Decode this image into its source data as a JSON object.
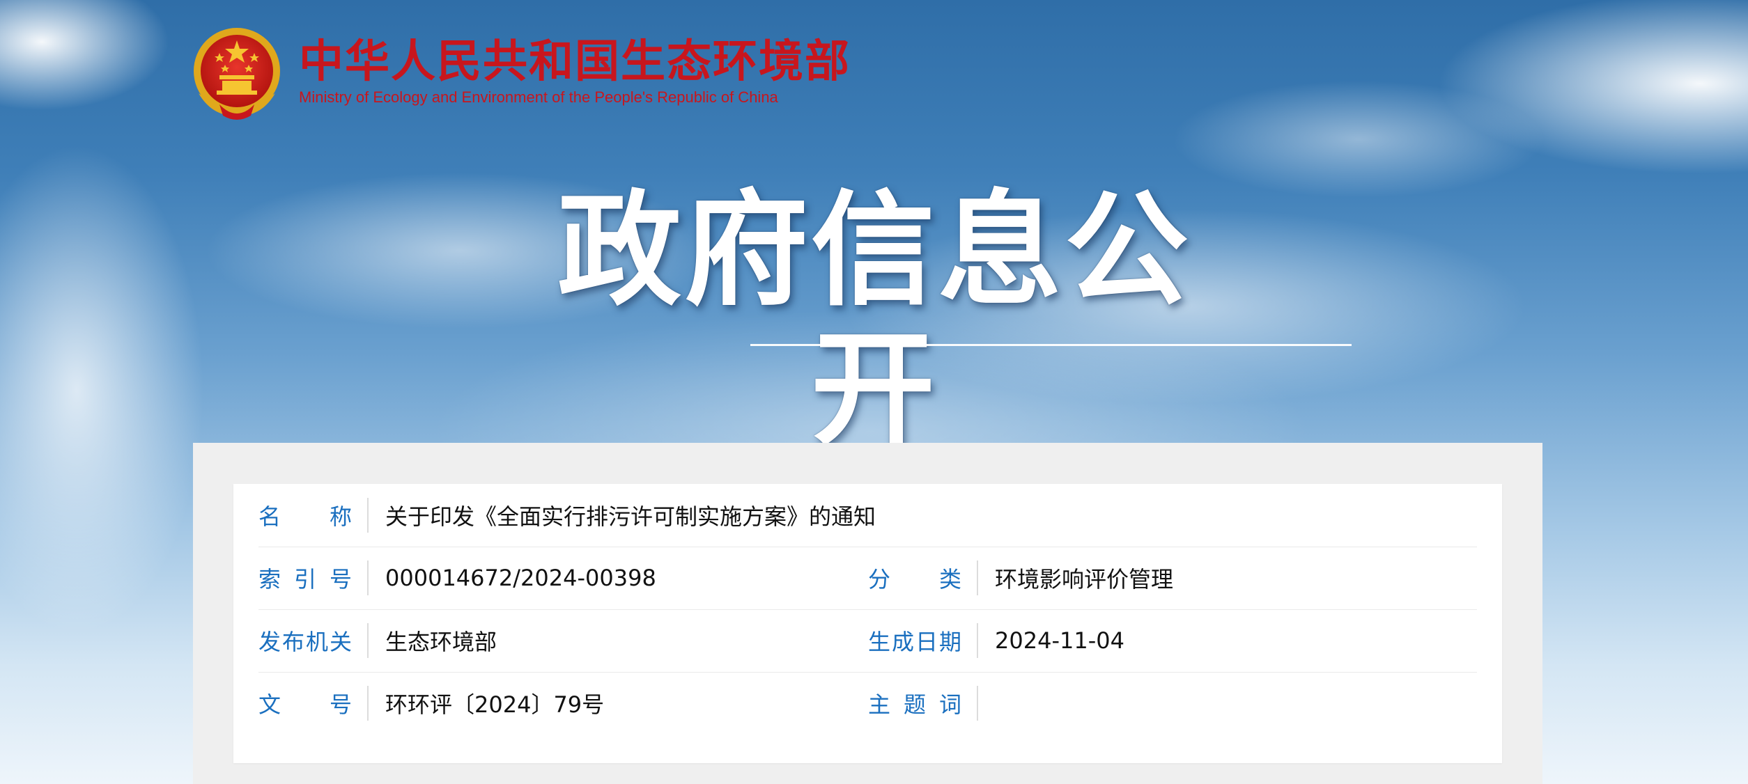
{
  "header": {
    "title_cn": "中华人民共和国生态环境部",
    "title_en": "Ministry of Ecology and Environment of the People's Republic of China",
    "emblem_icon": "national-emblem-icon"
  },
  "banner": {
    "title": "政府信息公开"
  },
  "colors": {
    "brand_red": "#c8161d",
    "label_blue": "#1a6fbf"
  },
  "info": {
    "name_label": "名　　称",
    "name_value": "关于印发《全面实行排污许可制实施方案》的通知",
    "index_label": "索 引 号",
    "index_value": "000014672/2024-00398",
    "category_label": "分　　类",
    "category_value": "环境影响评价管理",
    "publisher_label": "发布机关",
    "publisher_value": "生态环境部",
    "date_label": "生成日期",
    "date_value": "2024-11-04",
    "docno_label": "文　　号",
    "docno_value": "环环评〔2024〕79号",
    "keywords_label": "主 题 词",
    "keywords_value": ""
  }
}
